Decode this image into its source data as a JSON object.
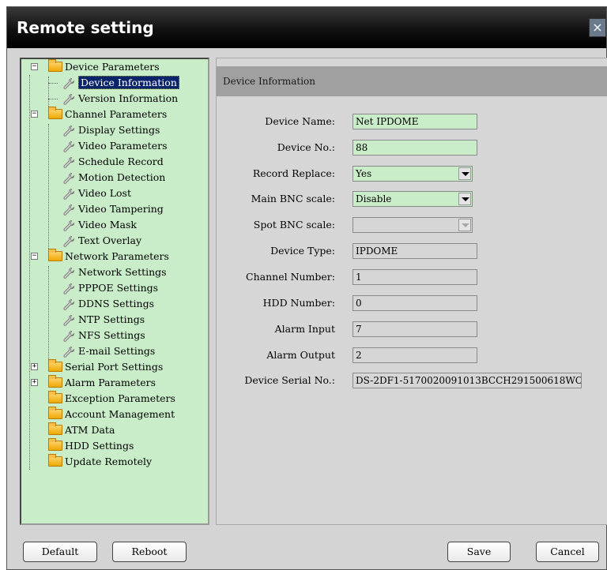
{
  "window": {
    "title": "Remote setting",
    "close_label": "×"
  },
  "tree": {
    "items": [
      {
        "label": "Device Parameters",
        "icon": "folder-icon",
        "expander": "−"
      },
      {
        "label": "Device Information",
        "icon": "wrench-icon",
        "selected": true
      },
      {
        "label": "Version Information",
        "icon": "wrench-icon"
      },
      {
        "label": "Channel Parameters",
        "icon": "folder-icon",
        "expander": "−"
      },
      {
        "label": "Display Settings",
        "icon": "wrench-icon"
      },
      {
        "label": "Video Parameters",
        "icon": "wrench-icon"
      },
      {
        "label": "Schedule Record",
        "icon": "wrench-icon"
      },
      {
        "label": "Motion Detection",
        "icon": "wrench-icon"
      },
      {
        "label": "Video Lost",
        "icon": "wrench-icon"
      },
      {
        "label": "Video Tampering",
        "icon": "wrench-icon"
      },
      {
        "label": "Video Mask",
        "icon": "wrench-icon"
      },
      {
        "label": "Text Overlay",
        "icon": "wrench-icon"
      },
      {
        "label": "Network Parameters",
        "icon": "folder-icon",
        "expander": "−"
      },
      {
        "label": "Network Settings",
        "icon": "wrench-icon"
      },
      {
        "label": "PPPOE Settings",
        "icon": "wrench-icon"
      },
      {
        "label": "DDNS Settings",
        "icon": "wrench-icon"
      },
      {
        "label": "NTP Settings",
        "icon": "wrench-icon"
      },
      {
        "label": "NFS Settings",
        "icon": "wrench-icon"
      },
      {
        "label": "E-mail Settings",
        "icon": "wrench-icon"
      },
      {
        "label": "Serial Port Settings",
        "icon": "folder-icon",
        "expander": "+"
      },
      {
        "label": "Alarm Parameters",
        "icon": "folder-icon",
        "expander": "+"
      },
      {
        "label": "Exception Parameters",
        "icon": "folder-icon"
      },
      {
        "label": "Account Management",
        "icon": "folder-icon"
      },
      {
        "label": "ATM Data",
        "icon": "folder-icon"
      },
      {
        "label": "HDD Settings",
        "icon": "folder-icon"
      },
      {
        "label": "Update Remotely",
        "icon": "folder-icon"
      }
    ]
  },
  "panel": {
    "header": "Device Information",
    "fields": {
      "device_name": {
        "label": "Device Name:",
        "value": "Net IPDOME"
      },
      "device_no": {
        "label": "Device No.:",
        "value": "88"
      },
      "record_replace": {
        "label": "Record Replace:",
        "value": "Yes"
      },
      "main_bnc_scale": {
        "label": "Main BNC scale:",
        "value": "Disable"
      },
      "spot_bnc_scale": {
        "label": "Spot BNC scale:",
        "value": ""
      },
      "device_type": {
        "label": "Device Type:",
        "value": "IPDOME"
      },
      "channel_number": {
        "label": "Channel Number:",
        "value": "1"
      },
      "hdd_number": {
        "label": "HDD Number:",
        "value": "0"
      },
      "alarm_input": {
        "label": "Alarm Input",
        "value": "7"
      },
      "alarm_output": {
        "label": "Alarm Output",
        "value": "2"
      },
      "device_serial_no": {
        "label": "Device Serial No.:",
        "value": "DS-2DF1-5170020091013BCCH291500618WC"
      }
    }
  },
  "buttons": {
    "default": "Default",
    "reboot": "Reboot",
    "save": "Save",
    "cancel": "Cancel"
  },
  "colors": {
    "field_green": "#c9ecc9",
    "selection_blue": "#0a246a",
    "titlebar": "#000000"
  }
}
